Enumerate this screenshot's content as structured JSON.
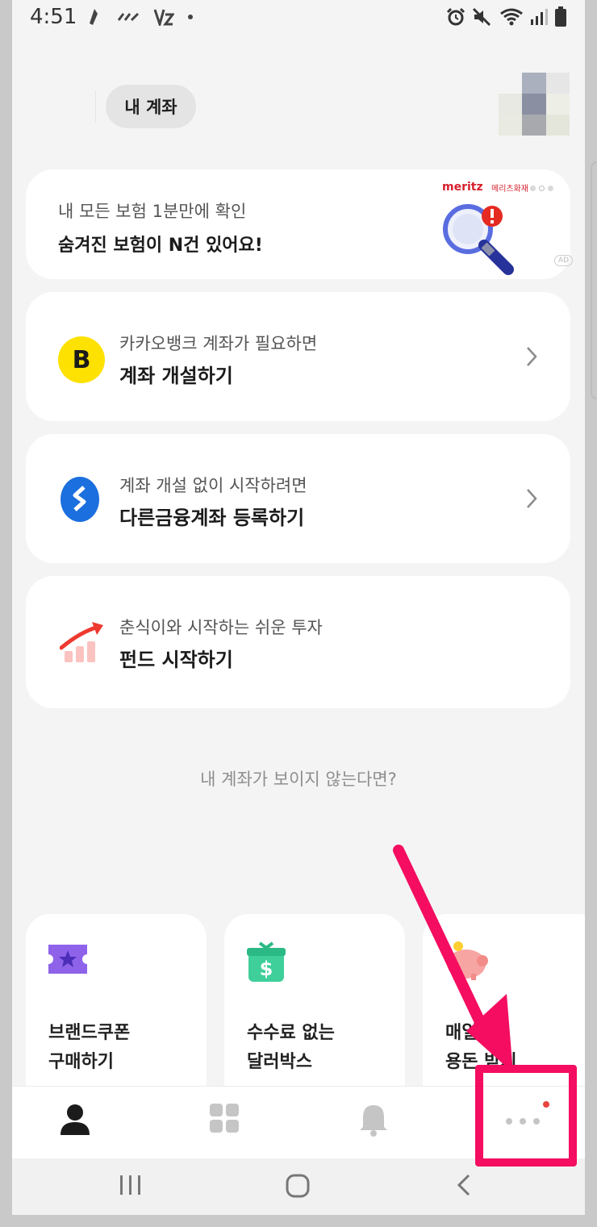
{
  "status_bar": {
    "time": "4:51",
    "left_icons": [
      "notification-icon",
      "ezl-icon",
      "vpn-icon",
      "dot-icon"
    ],
    "right_icons": [
      "alarm-icon",
      "mute-icon",
      "wifi-icon",
      "signal-icon",
      "battery-icon"
    ]
  },
  "header": {
    "tab_label": "내 계좌"
  },
  "ad_card": {
    "line1": "내 모든 보험 1분만에 확인",
    "line2": "숨겨진 보험이 N건 있어요!",
    "brand": "meritz",
    "brand_sub": "메리츠화재",
    "badge": "AD"
  },
  "account_cards": [
    {
      "line1": "카카오뱅크 계좌가 필요하면",
      "line2": "계좌 개설하기",
      "icon_letter": "B"
    },
    {
      "line1": "계좌 개설 없이 시작하려면",
      "line2": "다른금융계좌 등록하기"
    },
    {
      "line1": "춘식이와 시작하는 쉬운 투자",
      "line2": "펀드 시작하기"
    }
  ],
  "help_link": "내 계좌가 보이지 않는다면?",
  "promos": [
    {
      "text": "브랜드쿠폰\n구매하기",
      "icon": "coupon-icon"
    },
    {
      "text": "수수료 없는\n달러박스",
      "icon": "dollar-box-icon"
    },
    {
      "text": "매일\n용돈 받기",
      "icon": "piggy-bank-icon"
    }
  ],
  "bottom_nav": [
    "person-icon",
    "grid-icon",
    "bell-icon",
    "more-icon"
  ],
  "colors": {
    "accent_yellow": "#fde100",
    "toss_blue": "#1b6fde",
    "annotation_pink": "#f40d60",
    "notice_red": "#e8453c"
  }
}
